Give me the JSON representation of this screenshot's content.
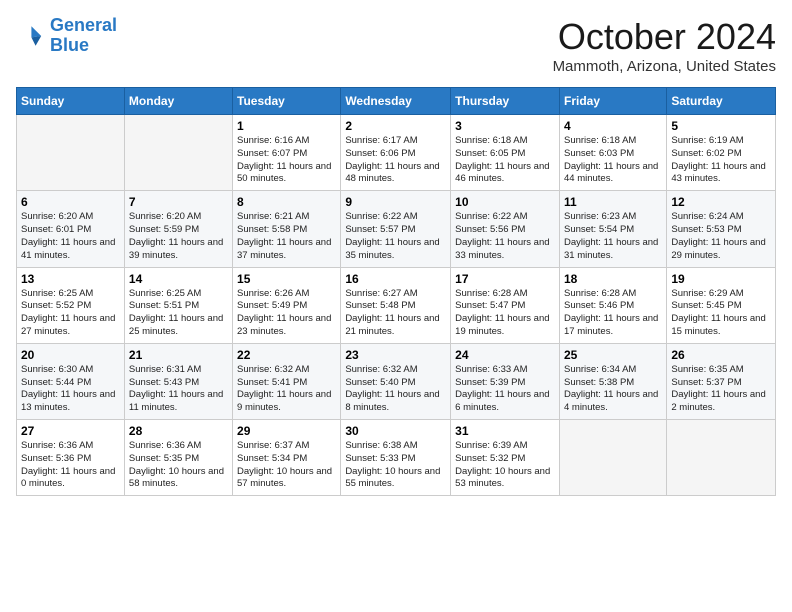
{
  "logo": {
    "line1": "General",
    "line2": "Blue"
  },
  "title": "October 2024",
  "location": "Mammoth, Arizona, United States",
  "weekdays": [
    "Sunday",
    "Monday",
    "Tuesday",
    "Wednesday",
    "Thursday",
    "Friday",
    "Saturday"
  ],
  "weeks": [
    [
      {
        "day": "",
        "info": ""
      },
      {
        "day": "",
        "info": ""
      },
      {
        "day": "1",
        "info": "Sunrise: 6:16 AM\nSunset: 6:07 PM\nDaylight: 11 hours and 50 minutes."
      },
      {
        "day": "2",
        "info": "Sunrise: 6:17 AM\nSunset: 6:06 PM\nDaylight: 11 hours and 48 minutes."
      },
      {
        "day": "3",
        "info": "Sunrise: 6:18 AM\nSunset: 6:05 PM\nDaylight: 11 hours and 46 minutes."
      },
      {
        "day": "4",
        "info": "Sunrise: 6:18 AM\nSunset: 6:03 PM\nDaylight: 11 hours and 44 minutes."
      },
      {
        "day": "5",
        "info": "Sunrise: 6:19 AM\nSunset: 6:02 PM\nDaylight: 11 hours and 43 minutes."
      }
    ],
    [
      {
        "day": "6",
        "info": "Sunrise: 6:20 AM\nSunset: 6:01 PM\nDaylight: 11 hours and 41 minutes."
      },
      {
        "day": "7",
        "info": "Sunrise: 6:20 AM\nSunset: 5:59 PM\nDaylight: 11 hours and 39 minutes."
      },
      {
        "day": "8",
        "info": "Sunrise: 6:21 AM\nSunset: 5:58 PM\nDaylight: 11 hours and 37 minutes."
      },
      {
        "day": "9",
        "info": "Sunrise: 6:22 AM\nSunset: 5:57 PM\nDaylight: 11 hours and 35 minutes."
      },
      {
        "day": "10",
        "info": "Sunrise: 6:22 AM\nSunset: 5:56 PM\nDaylight: 11 hours and 33 minutes."
      },
      {
        "day": "11",
        "info": "Sunrise: 6:23 AM\nSunset: 5:54 PM\nDaylight: 11 hours and 31 minutes."
      },
      {
        "day": "12",
        "info": "Sunrise: 6:24 AM\nSunset: 5:53 PM\nDaylight: 11 hours and 29 minutes."
      }
    ],
    [
      {
        "day": "13",
        "info": "Sunrise: 6:25 AM\nSunset: 5:52 PM\nDaylight: 11 hours and 27 minutes."
      },
      {
        "day": "14",
        "info": "Sunrise: 6:25 AM\nSunset: 5:51 PM\nDaylight: 11 hours and 25 minutes."
      },
      {
        "day": "15",
        "info": "Sunrise: 6:26 AM\nSunset: 5:49 PM\nDaylight: 11 hours and 23 minutes."
      },
      {
        "day": "16",
        "info": "Sunrise: 6:27 AM\nSunset: 5:48 PM\nDaylight: 11 hours and 21 minutes."
      },
      {
        "day": "17",
        "info": "Sunrise: 6:28 AM\nSunset: 5:47 PM\nDaylight: 11 hours and 19 minutes."
      },
      {
        "day": "18",
        "info": "Sunrise: 6:28 AM\nSunset: 5:46 PM\nDaylight: 11 hours and 17 minutes."
      },
      {
        "day": "19",
        "info": "Sunrise: 6:29 AM\nSunset: 5:45 PM\nDaylight: 11 hours and 15 minutes."
      }
    ],
    [
      {
        "day": "20",
        "info": "Sunrise: 6:30 AM\nSunset: 5:44 PM\nDaylight: 11 hours and 13 minutes."
      },
      {
        "day": "21",
        "info": "Sunrise: 6:31 AM\nSunset: 5:43 PM\nDaylight: 11 hours and 11 minutes."
      },
      {
        "day": "22",
        "info": "Sunrise: 6:32 AM\nSunset: 5:41 PM\nDaylight: 11 hours and 9 minutes."
      },
      {
        "day": "23",
        "info": "Sunrise: 6:32 AM\nSunset: 5:40 PM\nDaylight: 11 hours and 8 minutes."
      },
      {
        "day": "24",
        "info": "Sunrise: 6:33 AM\nSunset: 5:39 PM\nDaylight: 11 hours and 6 minutes."
      },
      {
        "day": "25",
        "info": "Sunrise: 6:34 AM\nSunset: 5:38 PM\nDaylight: 11 hours and 4 minutes."
      },
      {
        "day": "26",
        "info": "Sunrise: 6:35 AM\nSunset: 5:37 PM\nDaylight: 11 hours and 2 minutes."
      }
    ],
    [
      {
        "day": "27",
        "info": "Sunrise: 6:36 AM\nSunset: 5:36 PM\nDaylight: 11 hours and 0 minutes."
      },
      {
        "day": "28",
        "info": "Sunrise: 6:36 AM\nSunset: 5:35 PM\nDaylight: 10 hours and 58 minutes."
      },
      {
        "day": "29",
        "info": "Sunrise: 6:37 AM\nSunset: 5:34 PM\nDaylight: 10 hours and 57 minutes."
      },
      {
        "day": "30",
        "info": "Sunrise: 6:38 AM\nSunset: 5:33 PM\nDaylight: 10 hours and 55 minutes."
      },
      {
        "day": "31",
        "info": "Sunrise: 6:39 AM\nSunset: 5:32 PM\nDaylight: 10 hours and 53 minutes."
      },
      {
        "day": "",
        "info": ""
      },
      {
        "day": "",
        "info": ""
      }
    ]
  ]
}
